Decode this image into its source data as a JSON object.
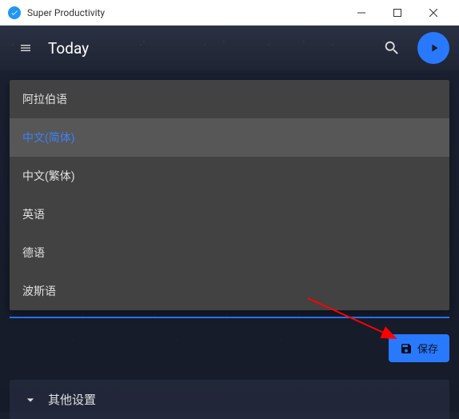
{
  "window": {
    "title": "Super Productivity"
  },
  "header": {
    "title": "Today"
  },
  "language_dropdown": {
    "items": [
      {
        "label": "阿拉伯语",
        "selected": false
      },
      {
        "label": "中文(简体)",
        "selected": true
      },
      {
        "label": "中文(繁体)",
        "selected": false
      },
      {
        "label": "英语",
        "selected": false
      },
      {
        "label": "德语",
        "selected": false
      },
      {
        "label": "波斯语",
        "selected": false
      }
    ]
  },
  "buttons": {
    "save": "保存"
  },
  "sections": {
    "other_settings": "其他设置"
  },
  "colors": {
    "accent": "#2979ff",
    "selected_text": "#3b82f6"
  }
}
